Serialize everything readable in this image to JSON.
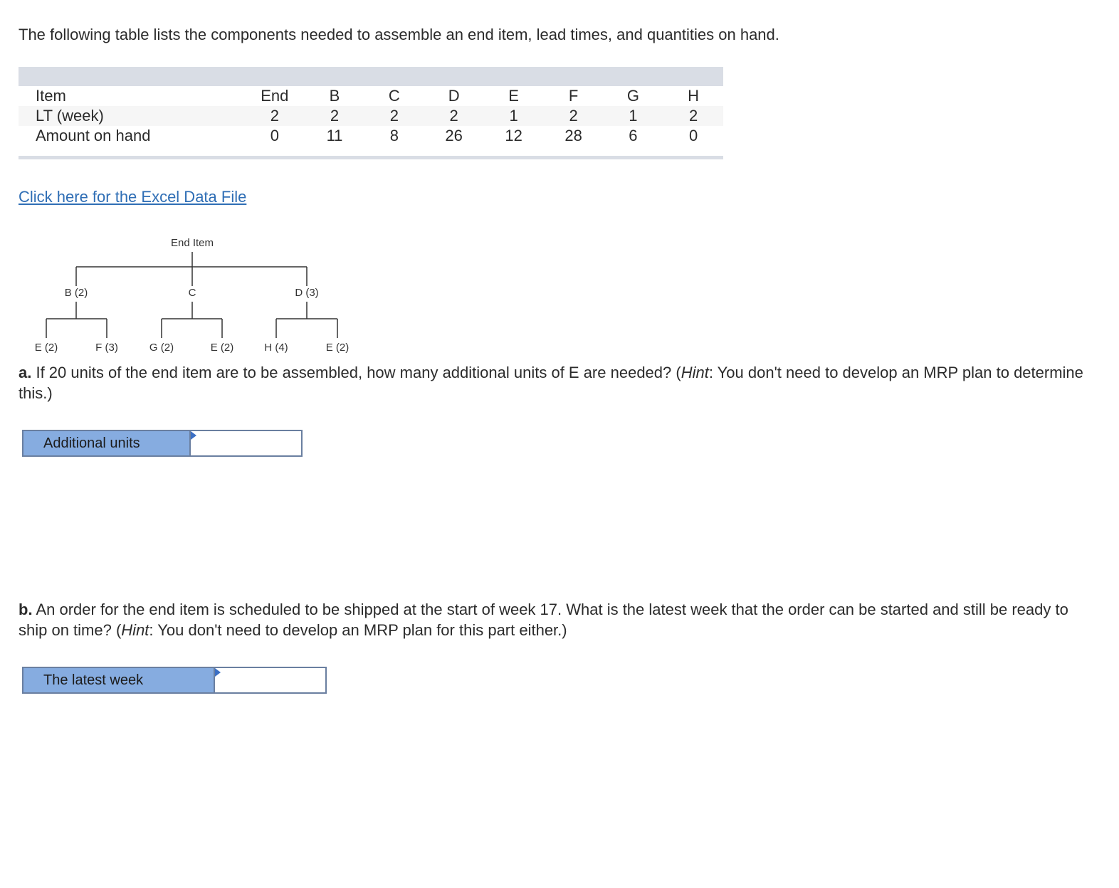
{
  "intro": "The following table lists the components needed to assemble an end item, lead times, and quantities on hand.",
  "table": {
    "rows": [
      {
        "label": "Item",
        "values": [
          "End",
          "B",
          "C",
          "D",
          "E",
          "F",
          "G",
          "H"
        ]
      },
      {
        "label": "LT (week)",
        "values": [
          "2",
          "2",
          "2",
          "2",
          "1",
          "2",
          "1",
          "2"
        ]
      },
      {
        "label": "Amount on hand",
        "values": [
          "0",
          "11",
          "8",
          "26",
          "12",
          "28",
          "6",
          "0"
        ]
      }
    ]
  },
  "excel_link": "Click here for the Excel Data File",
  "tree": {
    "root": "End Item",
    "level1": [
      "B (2)",
      "C",
      "D (3)"
    ],
    "level2": [
      "E (2)",
      "F (3)",
      "G (2)",
      "E (2)",
      "H (4)",
      "E (2)"
    ]
  },
  "question_a": {
    "prefix": "a.",
    "text1": " If 20 units of the end item are to be assembled, how many additional units of E are needed? (",
    "hint": "Hint",
    "text2": ": You don't need to develop an MRP plan to determine this.)",
    "answer_label": "Additional units",
    "answer_value": ""
  },
  "question_b": {
    "prefix": "b.",
    "text1": " An order for the end item is scheduled to be shipped at the start of week 17. What is the latest week that the order can be started and still be ready to ship on time? (",
    "hint": "Hint",
    "text2": ": You don't need to develop an MRP plan for this part either.)",
    "answer_label": "The latest week",
    "answer_value": ""
  }
}
